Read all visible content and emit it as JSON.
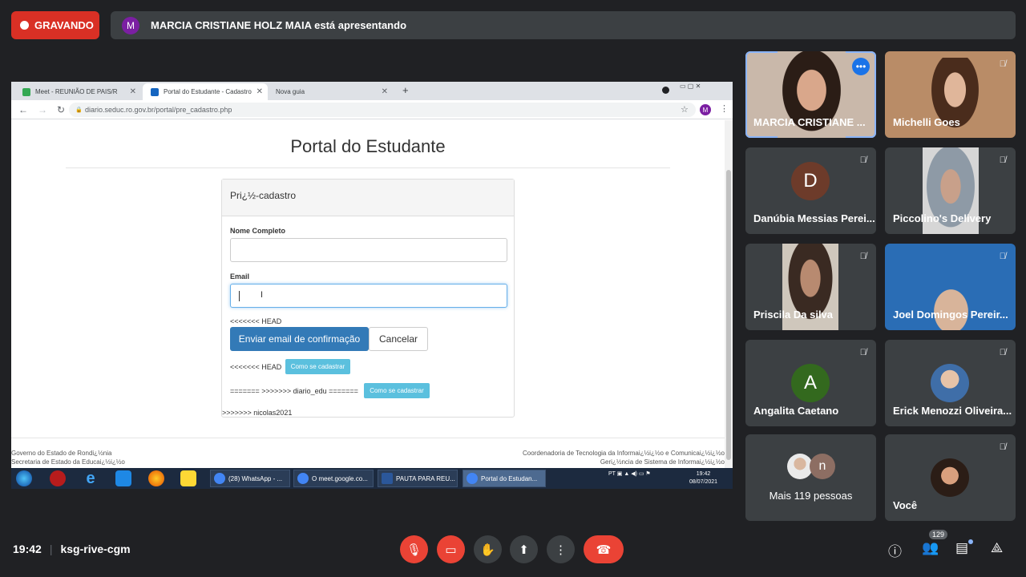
{
  "recording": {
    "label": "GRAVANDO"
  },
  "presenting": {
    "avatar_letter": "M",
    "text": "MARCIA CRISTIANE HOLZ MAIA está apresentando"
  },
  "browser": {
    "tabs": [
      {
        "label": "Meet - REUNIÃO DE PAIS/R",
        "active": false
      },
      {
        "label": "Portal do Estudante - Cadastro",
        "active": true
      },
      {
        "label": "Nova guia",
        "active": false
      }
    ],
    "url": "diario.seduc.ro.gov.br/portal/pre_cadastro.php",
    "profile_letter": "M"
  },
  "portal": {
    "title": "Portal do Estudante",
    "panel_heading": "Pri¿½-cadastro",
    "name_label": "Nome Completo",
    "email_label": "Email",
    "conflict_1": "<<<<<<< HEAD",
    "send_button": "Enviar email de confirmação",
    "cancel_button": "Cancelar",
    "conflict_2": "<<<<<<< HEAD",
    "how_to_button_1": "Como se cadastrar",
    "conflict_3": "======= >>>>>>> diario_edu =======",
    "how_to_button_2": "Como se cadastrar",
    "conflict_4": ">>>>>>> nicolas2021",
    "footer_left_1": "Governo do Estado de Rondi¿½nia",
    "footer_left_2": "Secretaria de Estado da Educai¿½i¿½o",
    "footer_right_1": "Coordenadoria de Tecnologia da Informai¿½i¿½o e Comunicai¿½i¿½o",
    "footer_right_2": "Geri¿½ncia de Sistema de Informai¿½i¿½o"
  },
  "taskbar": {
    "apps": [
      {
        "label": "(28) WhatsApp - ...",
        "color": "#4285f4"
      },
      {
        "label": "O meet.google.co...",
        "color": "#4285f4"
      },
      {
        "label": "PAUTA PARA REU...",
        "color": "#2b579a"
      },
      {
        "label": "Portal do Estudan...",
        "color": "#4285f4"
      }
    ],
    "lang": "PT",
    "time": "19:42",
    "date": "08/07/2021"
  },
  "participants": [
    {
      "name": "MARCIA CRISTIANE ...",
      "speaking": true
    },
    {
      "name": "Michelli Goes",
      "muted": true
    },
    {
      "name": "Danúbia Messias Perei...",
      "letter": "D",
      "color": "#6d3b2a",
      "muted": true
    },
    {
      "name": "Piccolino's Delivery",
      "muted": true
    },
    {
      "name": "Priscila Da silva",
      "muted": true
    },
    {
      "name": "Joel Domingos Pereir...",
      "muted": true
    },
    {
      "name": "Angalita Caetano",
      "letter": "A",
      "color": "#33691e",
      "muted": true
    },
    {
      "name": "Erick Menozzi Oliveira...",
      "muted": true
    },
    {
      "name": "Mais 119 pessoas",
      "letter": "n",
      "color": "#8d6e63"
    },
    {
      "name": "Você",
      "muted": true
    }
  ],
  "meeting": {
    "time": "19:42",
    "code": "ksg-rive-cgm",
    "participant_count": "129"
  }
}
